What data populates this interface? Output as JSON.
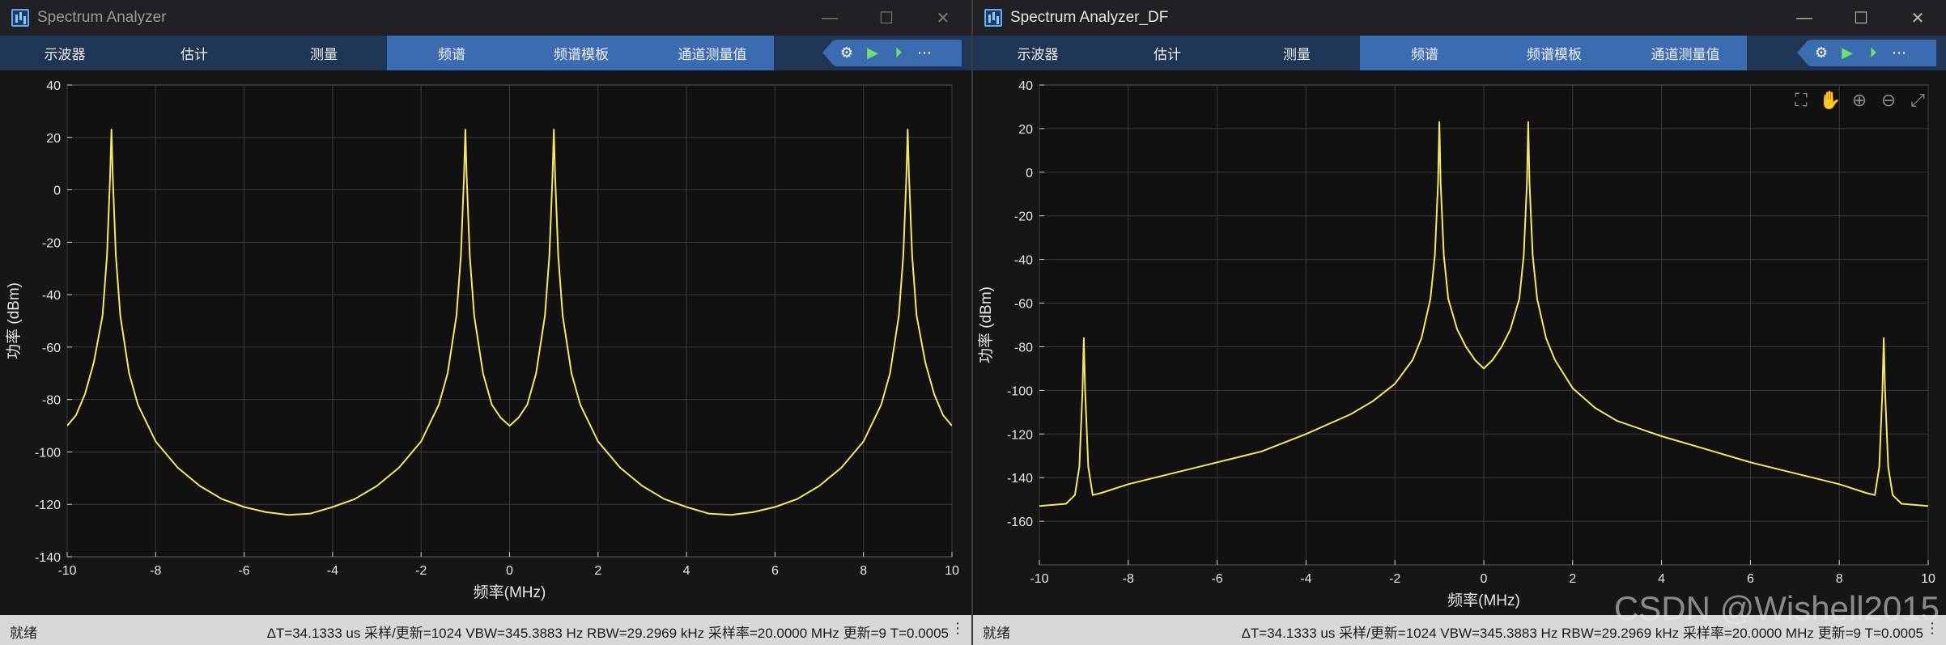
{
  "windows": [
    {
      "title": "Spectrum Analyzer",
      "tabs": [
        "示波器",
        "估计",
        "测量",
        "频谱",
        "频谱模板",
        "通道测量值"
      ],
      "active_tabs": [
        3,
        4,
        5
      ],
      "tools": [
        "settings-gear-icon",
        "run-icon",
        "step-forward-icon",
        "more-icon"
      ],
      "status_left": "就绪",
      "status_right": "ΔT=34.1333 us  采样/更新=1024  VBW=345.3883 Hz  RBW=29.2969 kHz  采样率=20.0000 MHz  更新=9  T=0.0005",
      "chart_data": {
        "type": "line",
        "xlabel": "频率(MHz)",
        "ylabel": "功率 (dBm)",
        "xlim": [
          -10,
          10
        ],
        "ylim": [
          -140,
          40
        ],
        "xticks": [
          -10,
          -8,
          -6,
          -4,
          -2,
          0,
          2,
          4,
          6,
          8,
          10
        ],
        "yticks": [
          40,
          20,
          0,
          -20,
          -40,
          -60,
          -80,
          -100,
          -120,
          -140
        ],
        "grid": true,
        "line_color": "#f5e56b",
        "series": [
          {
            "x": [
              -10,
              -9.8,
              -9.6,
              -9.4,
              -9.2,
              -9.1,
              -9.03,
              -9.0,
              -8.97,
              -8.9,
              -8.8,
              -8.6,
              -8.4,
              -8.0,
              -7.5,
              -7.0,
              -6.5,
              -6.0,
              -5.5,
              -5.0,
              -4.5,
              -4.0,
              -3.5,
              -3.0,
              -2.5,
              -2.0,
              -1.6,
              -1.4,
              -1.2,
              -1.1,
              -1.03,
              -1.0,
              -0.97,
              -0.9,
              -0.8,
              -0.6,
              -0.4,
              -0.2,
              0,
              0.2,
              0.4,
              0.6,
              0.8,
              0.9,
              0.97,
              1.0,
              1.03,
              1.1,
              1.2,
              1.4,
              1.6,
              2.0,
              2.5,
              3.0,
              3.5,
              4.0,
              4.5,
              5.0,
              5.5,
              6.0,
              6.5,
              7.0,
              7.5,
              8.0,
              8.4,
              8.6,
              8.8,
              8.9,
              8.97,
              9.0,
              9.03,
              9.1,
              9.2,
              9.4,
              9.6,
              9.8,
              10
            ],
            "y": [
              -90,
              -86,
              -78,
              -66,
              -48,
              -25,
              5,
              23,
              5,
              -25,
              -48,
              -70,
              -82,
              -96,
              -106,
              -113,
              -118,
              -121,
              -123,
              -124,
              -123.5,
              -121,
              -118,
              -113,
              -106,
              -96,
              -82,
              -70,
              -48,
              -25,
              5,
              23,
              5,
              -25,
              -48,
              -70,
              -82,
              -87,
              -90,
              -87,
              -82,
              -70,
              -48,
              -25,
              5,
              23,
              5,
              -25,
              -48,
              -70,
              -82,
              -96,
              -106,
              -113,
              -118,
              -121,
              -123.5,
              -124,
              -123,
              -121,
              -118,
              -113,
              -106,
              -96,
              -82,
              -70,
              -48,
              -25,
              5,
              23,
              5,
              -25,
              -48,
              -66,
              -78,
              -86,
              -90
            ]
          }
        ]
      }
    },
    {
      "title": "Spectrum Analyzer_DF",
      "tabs": [
        "示波器",
        "估计",
        "测量",
        "频谱",
        "频谱模板",
        "通道测量值"
      ],
      "active_tabs": [
        3,
        4,
        5
      ],
      "tools": [
        "settings-gear-icon",
        "run-icon",
        "step-forward-icon",
        "more-icon"
      ],
      "zoom_tools": [
        "fit-to-view-icon",
        "pan-hand-icon",
        "zoom-in-icon",
        "zoom-out-icon",
        "autoscale-icon"
      ],
      "status_left": "就绪",
      "status_right": "ΔT=34.1333 us  采样/更新=1024  VBW=345.3883 Hz  RBW=29.2969 kHz  采样率=20.0000 MHz  更新=9  T=0.0005",
      "chart_data": {
        "type": "line",
        "xlabel": "频率(MHz)",
        "ylabel": "功率 (dBm)",
        "xlim": [
          -10,
          10
        ],
        "ylim": [
          -180,
          40
        ],
        "xticks": [
          -10,
          -8,
          -6,
          -4,
          -2,
          0,
          2,
          4,
          6,
          8,
          10
        ],
        "yticks": [
          40,
          20,
          0,
          -20,
          -40,
          -60,
          -80,
          -100,
          -120,
          -140,
          -160
        ],
        "grid": true,
        "line_color": "#f5e56b",
        "series": [
          {
            "x": [
              -10,
              -9.4,
              -9.2,
              -9.1,
              -9.03,
              -9.0,
              -8.97,
              -8.9,
              -8.8,
              -8.6,
              -8.0,
              -7.0,
              -6.0,
              -5.0,
              -4.0,
              -3.0,
              -2.5,
              -2.0,
              -1.6,
              -1.4,
              -1.2,
              -1.1,
              -1.03,
              -1.0,
              -0.97,
              -0.9,
              -0.8,
              -0.6,
              -0.4,
              -0.2,
              0,
              0.2,
              0.4,
              0.6,
              0.8,
              0.9,
              0.97,
              1.0,
              1.03,
              1.1,
              1.2,
              1.4,
              1.6,
              2.0,
              2.5,
              3.0,
              4.0,
              5.0,
              6.0,
              7.0,
              8.0,
              8.6,
              8.8,
              8.9,
              8.97,
              9.0,
              9.03,
              9.1,
              9.2,
              9.4,
              10
            ],
            "y": [
              -153,
              -152,
              -148,
              -135,
              -100,
              -76,
              -100,
              -135,
              -148,
              -147,
              -143,
              -138,
              -133,
              -128,
              -120,
              -111,
              -105,
              -97,
              -86,
              -76,
              -58,
              -38,
              -5,
              23,
              -5,
              -38,
              -58,
              -72,
              -80,
              -86,
              -90,
              -86,
              -80,
              -72,
              -58,
              -38,
              -5,
              23,
              -5,
              -38,
              -58,
              -76,
              -86,
              -99,
              -108,
              -114,
              -121,
              -127,
              -133,
              -138,
              -143,
              -147,
              -148,
              -135,
              -100,
              -76,
              -100,
              -135,
              -148,
              -152,
              -153
            ]
          }
        ]
      }
    }
  ],
  "watermark": "CSDN @Wishell2015"
}
